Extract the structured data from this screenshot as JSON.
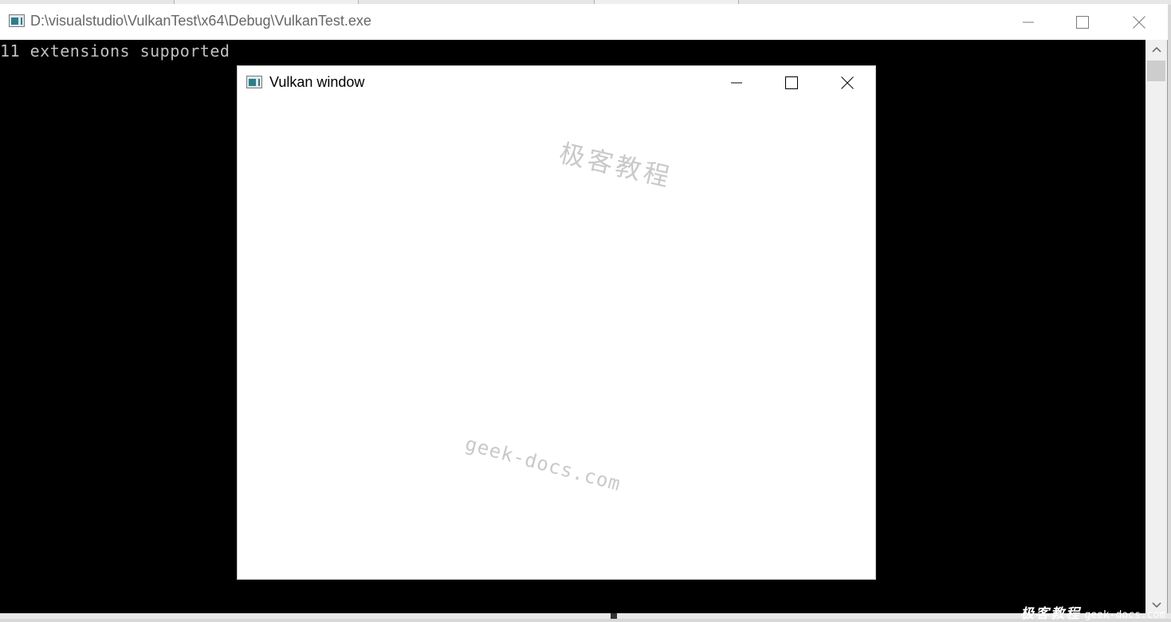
{
  "console": {
    "title": "D:\\visualstudio\\VulkanTest\\x64\\Debug\\VulkanTest.exe",
    "output": "11 extensions supported"
  },
  "vulkan_window": {
    "title": "Vulkan window"
  },
  "watermarks": {
    "chinese": "极客教程",
    "domain": "geek-docs.com"
  },
  "corner_watermark": {
    "chinese": "极客教程",
    "domain": "geek-docs.com"
  },
  "icons": {
    "app": "console-app-icon",
    "minimize": "minimize-icon",
    "maximize": "maximize-icon",
    "close": "close-icon",
    "scroll_up": "chevron-up-icon",
    "scroll_down": "chevron-down-icon"
  },
  "colors": {
    "console_background": "#000000",
    "console_text": "#c0c0c0",
    "titlebar_background": "#ffffff",
    "inactive_title_text": "#666666",
    "watermark": "#c9c9c9"
  }
}
